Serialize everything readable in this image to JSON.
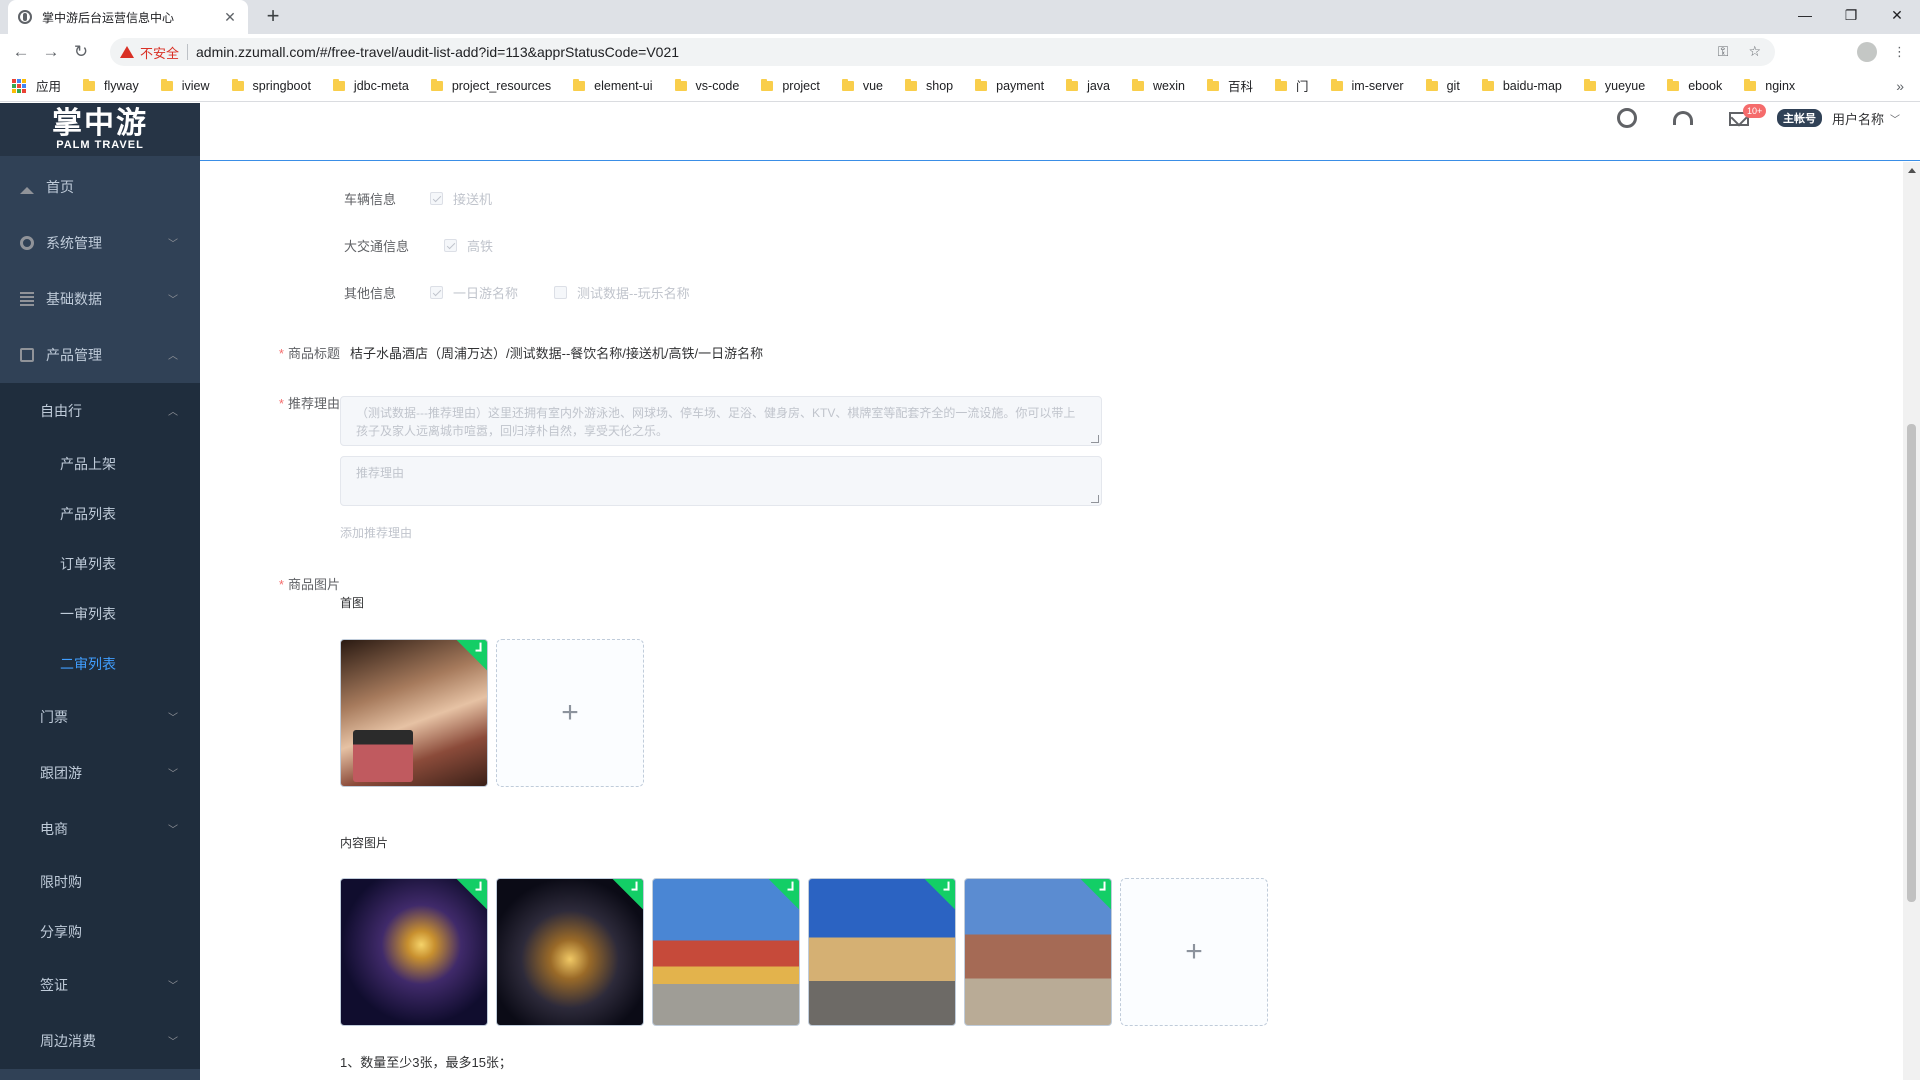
{
  "browser": {
    "tab_title": "掌中游后台运营信息中心",
    "insecure_label": "不安全",
    "url": "admin.zzumall.com/#/free-travel/audit-list-add?id=113&apprStatusCode=V021",
    "bookmarks": [
      "应用",
      "flyway",
      "iview",
      "springboot",
      "jdbc-meta",
      "project_resources",
      "element-ui",
      "vs-code",
      "project",
      "vue",
      "shop",
      "payment",
      "java",
      "wexin",
      "百科",
      "门",
      "im-server",
      "git",
      "baidu-map",
      "yueyue",
      "ebook",
      "nginx"
    ]
  },
  "logo": {
    "cn": "掌中游",
    "en": "PALM TRAVEL"
  },
  "sidebar": {
    "items": [
      {
        "label": "首页",
        "icon": "home-icon"
      },
      {
        "label": "系统管理",
        "icon": "gear-icon"
      },
      {
        "label": "基础数据",
        "icon": "list-icon"
      },
      {
        "label": "产品管理",
        "icon": "bag-icon"
      },
      {
        "label": "自由行"
      },
      {
        "label": "产品上架"
      },
      {
        "label": "产品列表"
      },
      {
        "label": "订单列表"
      },
      {
        "label": "一审列表"
      },
      {
        "label": "二审列表"
      },
      {
        "label": "门票"
      },
      {
        "label": "跟团游"
      },
      {
        "label": "电商"
      },
      {
        "label": "限时购"
      },
      {
        "label": "分享购"
      },
      {
        "label": "签证"
      },
      {
        "label": "周边消费"
      }
    ]
  },
  "header": {
    "badge": "10+",
    "account_tag": "主帐号",
    "username": "用户名称"
  },
  "form": {
    "vehicle": {
      "label": "车辆信息",
      "option": "接送机"
    },
    "transport": {
      "label": "大交通信息",
      "option": "高铁"
    },
    "other": {
      "label": "其他信息",
      "options": [
        "一日游名称",
        "测试数据--玩乐名称"
      ]
    },
    "title": {
      "label": "商品标题",
      "value": "桔子水晶酒店（周浦万达）/测试数据--餐饮名称/接送机/高铁/一日游名称"
    },
    "reason": {
      "label": "推荐理由",
      "value": "（测试数据---推荐理由）这里还拥有室内外游泳池、网球场、停车场、足浴、健身房、KTV、棋牌室等配套齐全的一流设施。你可以带上孩子及家人远离城市喧嚣，回归淳朴自然，享受天伦之乐。",
      "placeholder": "推荐理由",
      "add_link": "添加推荐理由"
    },
    "images": {
      "label": "商品图片",
      "cover_label": "首图",
      "content_label": "内容图片",
      "note": "1、数量至少3张，最多15张；"
    }
  }
}
